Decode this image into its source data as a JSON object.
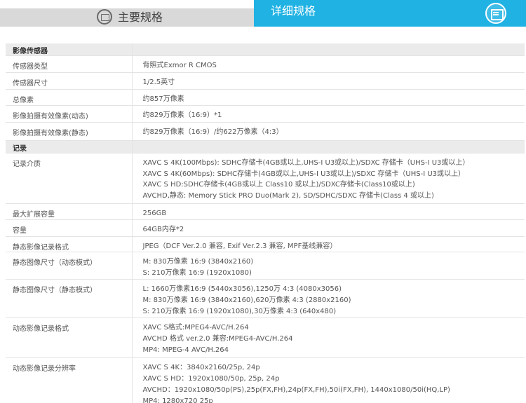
{
  "tabs": {
    "main_label": "主要规格",
    "detail_label": "详细规格"
  },
  "sections": [
    {
      "title": "影像传感器"
    },
    {
      "title": "记录"
    }
  ],
  "rows_sensor": [
    {
      "label": "传感器类型",
      "value": "背照式Exmor R CMOS"
    },
    {
      "label": "传感器尺寸",
      "value": "1/2.5英寸"
    },
    {
      "label": "总像素",
      "value": "约857万像素"
    },
    {
      "label": "影像拍摄有效像素(动态)",
      "value": "约829万像素（16:9）*1"
    },
    {
      "label": "影像拍摄有效像素(静态)",
      "value": "约829万像素（16:9）/约622万像素（4:3）"
    }
  ],
  "rows_record": [
    {
      "label": "记录介质",
      "lines": [
        "XAVC S 4K(100Mbps): SDHC存储卡(4GB或以上,UHS-I U3或以上)/SDXC 存储卡（UHS-I U3或以上）",
        "XAVC S 4K(60Mbps): SDHC存储卡(4GB或以上,UHS-I U3或以上)/SDXC 存储卡（UHS-I U3或以上）",
        "XAVC S HD:SDHC存储卡(4GB或以上 Class10 或以上)/SDXC存储卡(Class10或以上)",
        "AVCHD,静态: Memory Stick PRO Duo(Mark 2), SD/SDHC/SDXC 存储卡(Class 4 或以上)"
      ]
    },
    {
      "label": "最大扩展容量",
      "lines": [
        "256GB"
      ]
    },
    {
      "label": "容量",
      "lines": [
        "64GB内存*2"
      ]
    },
    {
      "label": "静态影像记录格式",
      "lines": [
        "JPEG（DCF Ver.2.0 兼容, Exif Ver.2.3 兼容, MPF基线兼容）"
      ]
    },
    {
      "label": "静态图像尺寸（动态模式）",
      "lines": [
        "M: 830万像素 16:9 (3840x2160)",
        "S: 210万像素 16:9 (1920x1080)"
      ]
    },
    {
      "label": "静态图像尺寸（静态模式）",
      "lines": [
        "L: 1660万像素16:9 (5440x3056),1250万 4:3 (4080x3056)",
        "M: 830万像素 16:9 (3840x2160),620万像素 4:3 (2880x2160)",
        "S: 210万像素 16:9 (1920x1080),30万像素 4:3 (640x480)"
      ]
    },
    {
      "label": "动态影像记录格式",
      "lines": [
        "XAVC S格式:MPEG4-AVC/H.264",
        "AVCHD 格式 ver.2.0 兼容:MPEG4-AVC/H.264",
        "MP4: MPEG-4 AVC/H.264"
      ]
    },
    {
      "label": "动态影像记录分辨率",
      "lines": [
        "XAVC S 4K：3840x2160/25p, 24p",
        "XAVC S HD：1920x1080/50p, 25p, 24p",
        "AVCHD：1920x1080/50p(PS),25p(FX,FH),24p(FX,FH),50i(FX,FH), 1440x1080/50i(HQ,LP)",
        "MP4: 1280x720 25p"
      ]
    }
  ]
}
